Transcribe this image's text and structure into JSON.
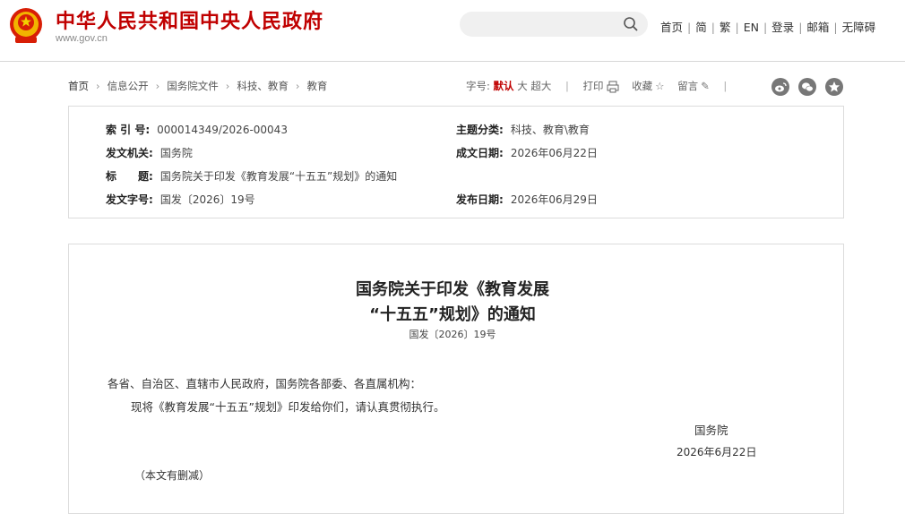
{
  "header": {
    "site_title": "中华人民共和国中央人民政府",
    "site_url": "www.gov.cn",
    "search": {
      "value": "",
      "placeholder": ""
    },
    "links": [
      "首页",
      "简",
      "繁",
      "EN",
      "登录",
      "邮箱",
      "无障碍"
    ]
  },
  "breadcrumb": [
    "首页",
    "信息公开",
    "国务院文件",
    "科技、教育",
    "教育"
  ],
  "tools": {
    "font_label": "字号:",
    "font_sizes": [
      "默认",
      "大",
      "超大"
    ],
    "print_label": "打印",
    "favorite_label": "收藏",
    "comment_label": "留言",
    "share_icons": [
      "weibo-icon",
      "wechat-icon",
      "favorite-star-icon"
    ]
  },
  "info": {
    "index_label": "索 引 号:",
    "index_value": "000014349/2026-00043",
    "category_label": "主题分类:",
    "category_value": "科技、教育\\教育",
    "issuer_label": "发文机关:",
    "issuer_value": "国务院",
    "created_label": "成文日期:",
    "created_value": "2026年06月22日",
    "title_label": "标　　题:",
    "title_value": "国务院关于印发《教育发展“十五五”规划》的通知",
    "docno_label": "发文字号:",
    "docno_value": "国发〔2026〕19号",
    "published_label": "发布日期:",
    "published_value": "2026年06月29日"
  },
  "document": {
    "title_line1": "国务院关于印发《教育发展",
    "title_line2": "“十五五”规划》的通知",
    "number": "国发〔2026〕19号",
    "salutation": "各省、自治区、直辖市人民政府，国务院各部委、各直属机构：",
    "body": "现将《教育发展“十五五”规划》印发给你们，请认真贯彻执行。",
    "signer": "国务院",
    "date": "2026年6月22日",
    "note": "（本文有删减）"
  },
  "colors": {
    "brand_red": "#c00000",
    "border": "#dcdcdc",
    "search_bg": "#f0f0f0"
  }
}
